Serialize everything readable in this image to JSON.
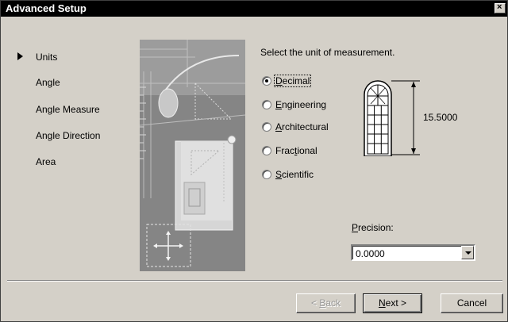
{
  "window": {
    "title": "Advanced Setup",
    "close_label": "×"
  },
  "steps": [
    {
      "label": "Units",
      "current": true
    },
    {
      "label": "Angle",
      "current": false
    },
    {
      "label": "Angle Measure",
      "current": false
    },
    {
      "label": "Angle Direction",
      "current": false
    },
    {
      "label": "Area",
      "current": false
    }
  ],
  "main": {
    "prompt": "Select the unit of measurement.",
    "options": [
      {
        "pre": "",
        "key": "D",
        "post": "ecimal",
        "selected": true
      },
      {
        "pre": "",
        "key": "E",
        "post": "ngineering",
        "selected": false
      },
      {
        "pre": "",
        "key": "A",
        "post": "rchitectural",
        "selected": false
      },
      {
        "pre": "Frac",
        "key": "t",
        "post": "ional",
        "selected": false
      },
      {
        "pre": "",
        "key": "S",
        "post": "cientific",
        "selected": false
      }
    ],
    "dimension_value": "15.5000",
    "precision": {
      "pre": "",
      "key": "P",
      "post": "recision:",
      "value": "0.0000"
    }
  },
  "buttons": {
    "back": {
      "pre": "< ",
      "key": "B",
      "post": "ack"
    },
    "next": {
      "pre": "",
      "key": "N",
      "post": "ext >"
    },
    "cancel": "Cancel"
  }
}
